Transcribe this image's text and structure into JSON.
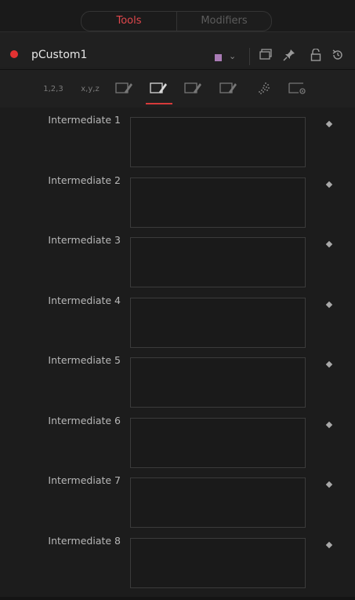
{
  "tabs": {
    "tools": "Tools",
    "modifiers": "Modifiers",
    "active": "tools"
  },
  "header": {
    "node_name": "pCustom1",
    "record_color": "#e23232",
    "swatch_color": "#a97bb5",
    "icons": [
      "chevron-down-icon",
      "window-icon",
      "pin-icon",
      "lock-icon",
      "reset-icon"
    ]
  },
  "toolbar": {
    "icons": [
      {
        "name": "numbers-tab-icon",
        "label": "1,2,3"
      },
      {
        "name": "xyz-tab-icon",
        "label": "x,y,z"
      },
      {
        "name": "edit-tab-icon-1",
        "label": ""
      },
      {
        "name": "edit-tab-icon-2",
        "label": ""
      },
      {
        "name": "edit-tab-icon-3",
        "label": ""
      },
      {
        "name": "edit-tab-icon-4",
        "label": ""
      },
      {
        "name": "particles-tab-icon",
        "label": ""
      },
      {
        "name": "settings-tab-icon",
        "label": ""
      }
    ],
    "active_index": 3,
    "accent_color": "#d63a3a"
  },
  "params": [
    {
      "label": "Intermediate 1",
      "value": ""
    },
    {
      "label": "Intermediate 2",
      "value": ""
    },
    {
      "label": "Intermediate 3",
      "value": ""
    },
    {
      "label": "Intermediate 4",
      "value": ""
    },
    {
      "label": "Intermediate 5",
      "value": ""
    },
    {
      "label": "Intermediate 6",
      "value": ""
    },
    {
      "label": "Intermediate 7",
      "value": ""
    },
    {
      "label": "Intermediate 8",
      "value": ""
    }
  ]
}
